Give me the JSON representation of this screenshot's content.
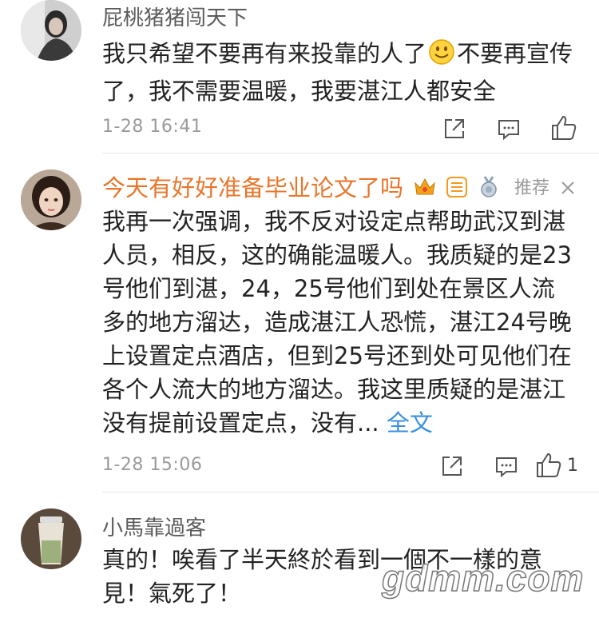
{
  "comments": [
    {
      "username": "屁桃猪猪闯天下",
      "text_part1": "我只希望不要再有来投靠的人了",
      "text_part2": "不要再宣传了，我不需要温暖，我要湛江人都安全",
      "time": "1-28 16:41",
      "icons": [
        "share-icon",
        "comment-icon",
        "like-icon"
      ]
    },
    {
      "username": "今天有好好准备毕业论文了吗",
      "recommend_label": "推荐",
      "text": "我再一次强调，我不反对设定点帮助武汉到湛人员，相反，这的确能温暖人。我质疑的是23号他们到湛，24，25号他们到处在景区人流多的地方溜达，造成湛江人恐慌，湛江24号晚上设置定点酒店，但到25号还到处可见他们在各个人流大的地方溜达。我这里质疑的是湛江没有提前设置定点，没有...",
      "more_link": "全文",
      "time": "1-28 15:06",
      "like_count": "1",
      "badges": [
        "crown-badge-icon",
        "yun-badge-icon",
        "medal-badge-icon"
      ]
    },
    {
      "username": "小馬靠過客",
      "text": "真的！唉看了半天終於看到一個不一樣的意見！氣死了！"
    }
  ],
  "watermark": "gdmm.com",
  "colors": {
    "vip_name": "#e8762b",
    "link": "#3a8fe0",
    "meta": "#9a9a9a"
  }
}
